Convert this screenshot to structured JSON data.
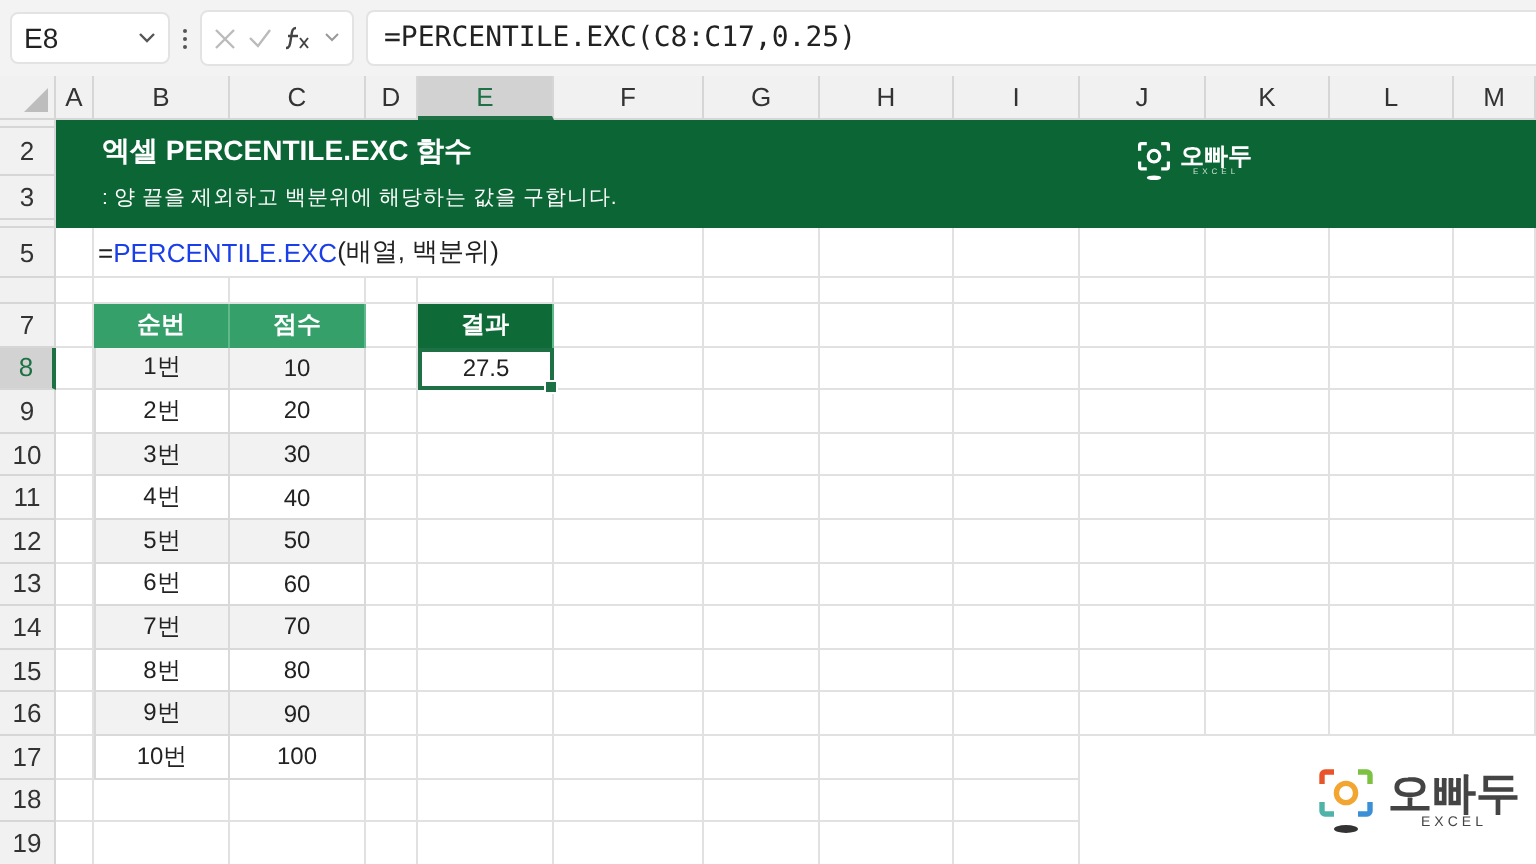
{
  "name_box": {
    "value": "E8"
  },
  "formula_bar": {
    "value": "=PERCENTILE.EXC(C8:C17,0.25)"
  },
  "columns": [
    {
      "label": "A",
      "selected": false
    },
    {
      "label": "B",
      "selected": false
    },
    {
      "label": "C",
      "selected": false
    },
    {
      "label": "D",
      "selected": false
    },
    {
      "label": "E",
      "selected": true
    },
    {
      "label": "F",
      "selected": false
    },
    {
      "label": "G",
      "selected": false
    },
    {
      "label": "H",
      "selected": false
    },
    {
      "label": "I",
      "selected": false
    },
    {
      "label": "J",
      "selected": false
    },
    {
      "label": "K",
      "selected": false
    },
    {
      "label": "L",
      "selected": false
    },
    {
      "label": "M",
      "selected": false
    }
  ],
  "rows": [
    {
      "label": "2",
      "selected": false
    },
    {
      "label": "3",
      "selected": false
    },
    {
      "label": "5",
      "selected": false
    },
    {
      "label": "7",
      "selected": false
    },
    {
      "label": "8",
      "selected": true
    },
    {
      "label": "9",
      "selected": false
    },
    {
      "label": "10",
      "selected": false
    },
    {
      "label": "11",
      "selected": false
    },
    {
      "label": "12",
      "selected": false
    },
    {
      "label": "13",
      "selected": false
    },
    {
      "label": "14",
      "selected": false
    },
    {
      "label": "15",
      "selected": false
    },
    {
      "label": "16",
      "selected": false
    },
    {
      "label": "17",
      "selected": false
    },
    {
      "label": "18",
      "selected": false
    },
    {
      "label": "19",
      "selected": false
    }
  ],
  "banner": {
    "title": "엑셀 PERCENTILE.EXC 함수",
    "subtitle": ": 양 끝을 제외하고 백분위에 해당하는 값을 구합니다.",
    "logo": {
      "name": "오빠두",
      "tag": "EXCEL"
    }
  },
  "syntax": {
    "prefix": "=",
    "function": "PERCENTILE.EXC",
    "args": "(배열, 백분위)"
  },
  "table": {
    "columns": [
      "순번",
      "점수"
    ],
    "rows": [
      [
        "1번",
        "10"
      ],
      [
        "2번",
        "20"
      ],
      [
        "3번",
        "30"
      ],
      [
        "4번",
        "40"
      ],
      [
        "5번",
        "50"
      ],
      [
        "6번",
        "60"
      ],
      [
        "7번",
        "70"
      ],
      [
        "8번",
        "80"
      ],
      [
        "9번",
        "90"
      ],
      [
        "10번",
        "100"
      ]
    ]
  },
  "result": {
    "header": "결과",
    "value": "27.5",
    "selected": true
  },
  "watermark_logo": {
    "name": "오빠두",
    "tag": "EXCEL"
  }
}
